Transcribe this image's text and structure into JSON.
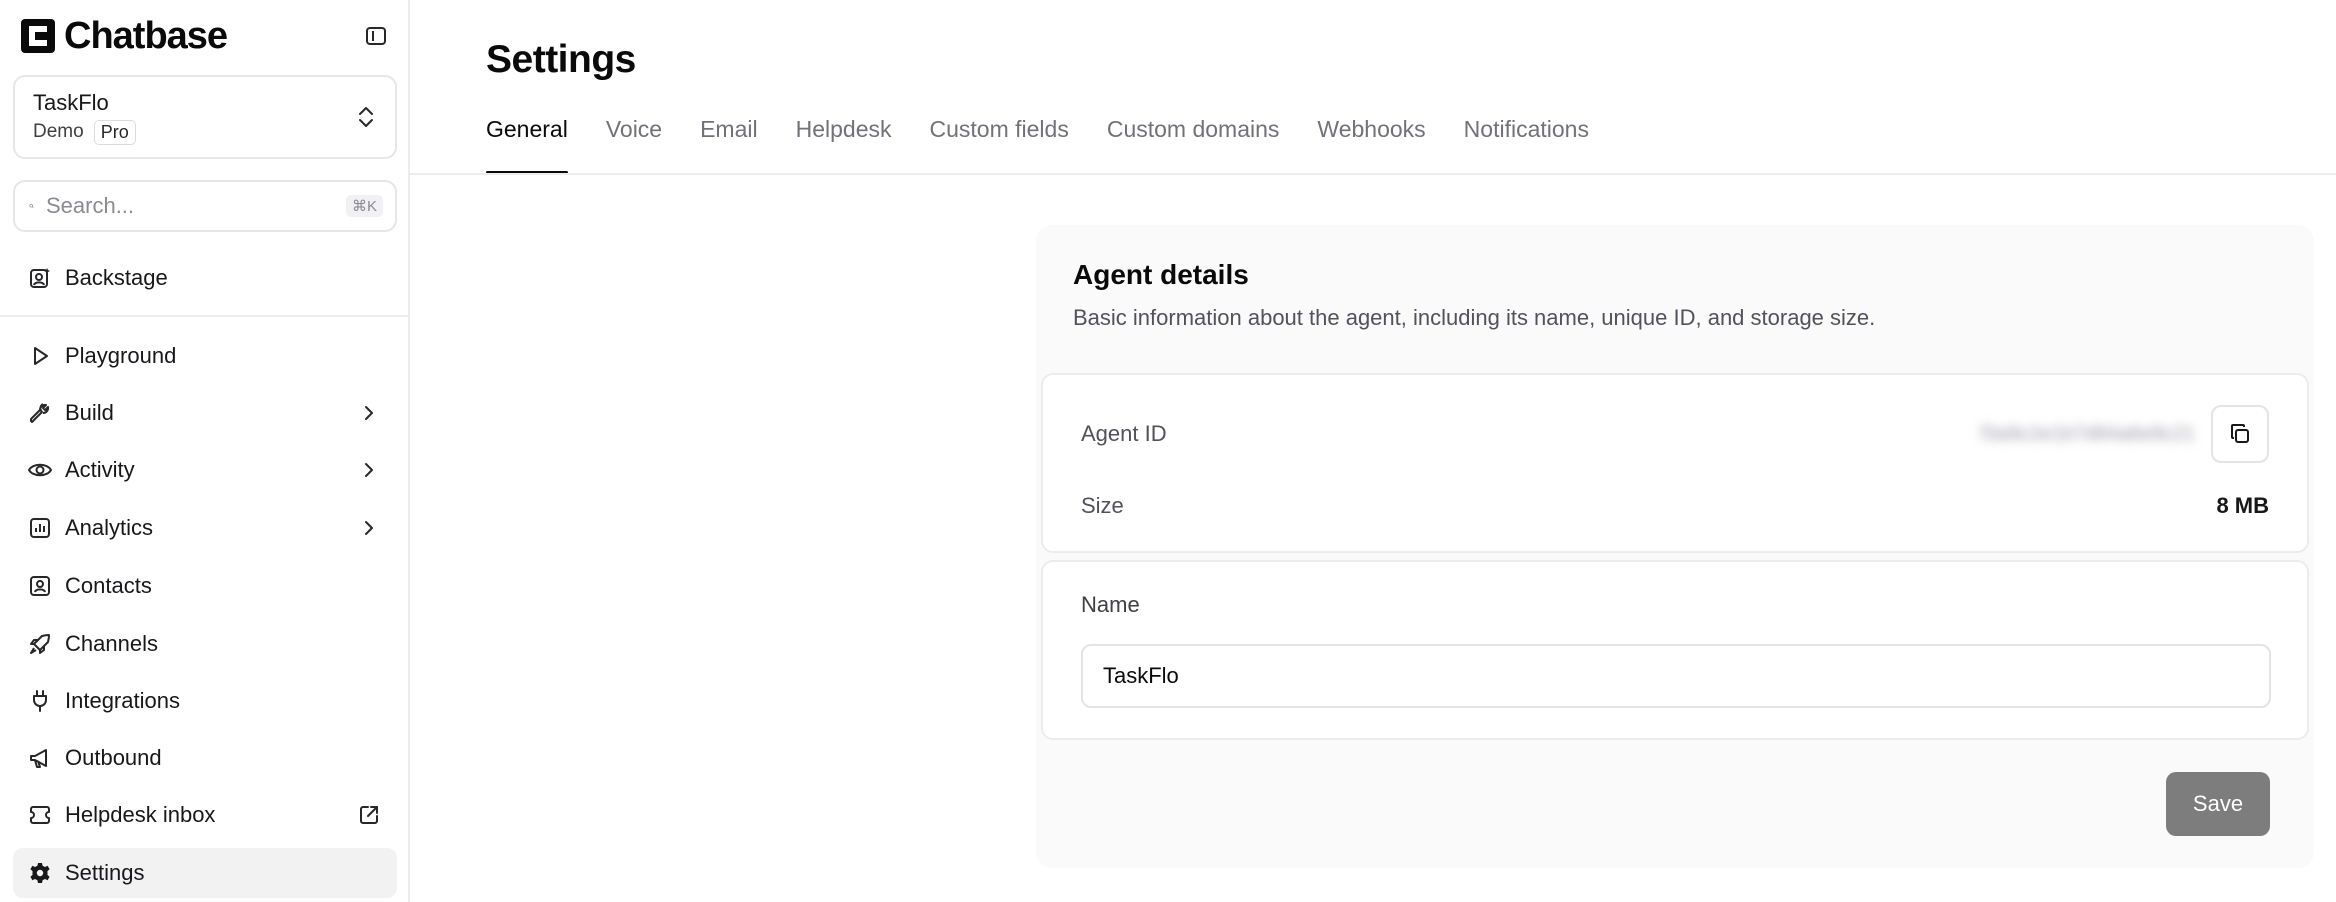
{
  "app": {
    "brand": "Chatbase",
    "logo_icon": "chatbase-logo-icon",
    "collapse_icon": "sidebar-toggle-icon"
  },
  "workspace": {
    "name": "TaskFlo",
    "subtitle": "Demo",
    "plan": "Pro",
    "icon": "chevron-up-down-icon"
  },
  "search": {
    "placeholder": "Search...",
    "shortcut": "⌘K"
  },
  "sidebar": {
    "top_item": {
      "label": "Backstage",
      "icon": "backstage-icon"
    },
    "items": [
      {
        "label": "Playground",
        "icon": "play-icon",
        "trail": ""
      },
      {
        "label": "Build",
        "icon": "wrench-icon",
        "trail": "chevron-right-icon"
      },
      {
        "label": "Activity",
        "icon": "eye-icon",
        "trail": "chevron-right-icon"
      },
      {
        "label": "Analytics",
        "icon": "bar-chart-icon",
        "trail": "chevron-right-icon"
      },
      {
        "label": "Contacts",
        "icon": "contact-icon",
        "trail": ""
      },
      {
        "label": "Channels",
        "icon": "rocket-icon",
        "trail": ""
      },
      {
        "label": "Integrations",
        "icon": "plug-icon",
        "trail": ""
      },
      {
        "label": "Outbound",
        "icon": "megaphone-icon",
        "trail": ""
      },
      {
        "label": "Helpdesk inbox",
        "icon": "ticket-icon",
        "trail": "external-link-icon"
      },
      {
        "label": "Settings",
        "icon": "gear-icon",
        "trail": "",
        "active": true
      }
    ]
  },
  "header": {
    "title": "Settings",
    "tabs": [
      {
        "label": "General",
        "active": true
      },
      {
        "label": "Voice"
      },
      {
        "label": "Email"
      },
      {
        "label": "Helpdesk"
      },
      {
        "label": "Custom fields"
      },
      {
        "label": "Custom domains"
      },
      {
        "label": "Webhooks"
      },
      {
        "label": "Notifications"
      }
    ]
  },
  "agent_details": {
    "title": "Agent details",
    "description": "Basic information about the agent, including its name, unique ID, and storage size.",
    "agent_id_label": "Agent ID",
    "agent_id_value": "f3a9c2e1b7d84a6e9c21",
    "size_label": "Size",
    "size_value": "8 MB",
    "name_label": "Name",
    "name_value": "TaskFlo",
    "save_label": "Save"
  }
}
